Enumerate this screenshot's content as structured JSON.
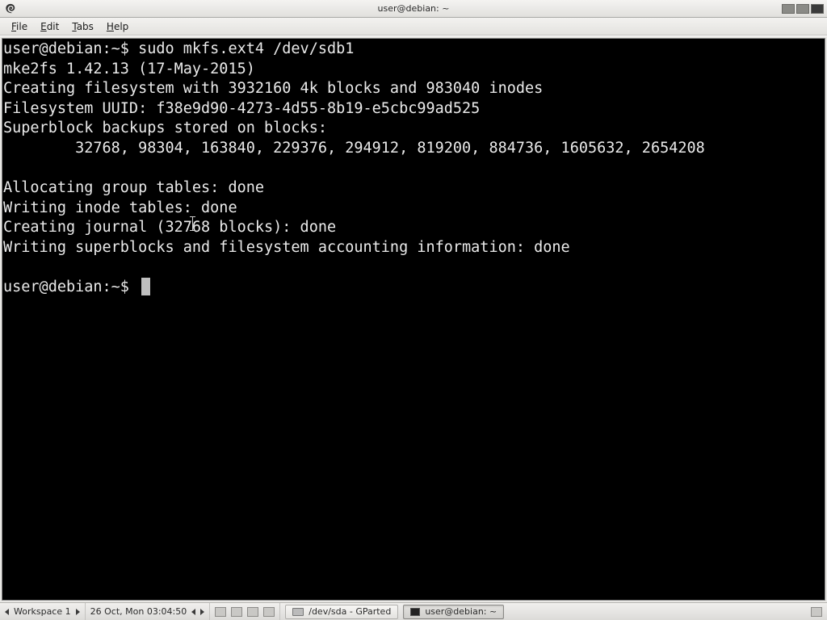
{
  "top_panel": {
    "title": "user@debian: ~"
  },
  "menubar": {
    "file": {
      "label": "File",
      "accel_index": 0
    },
    "edit": {
      "label": "Edit",
      "accel_index": 0
    },
    "tabs": {
      "label": "Tabs",
      "accel_index": 0
    },
    "help": {
      "label": "Help",
      "accel_index": 0
    }
  },
  "terminal": {
    "prompt": "user@debian:~$",
    "command": "sudo mkfs.ext4 /dev/sdb1",
    "out_line1": "mke2fs 1.42.13 (17-May-2015)",
    "out_line2": "Creating filesystem with 3932160 4k blocks and 983040 inodes",
    "out_line3": "Filesystem UUID: f38e9d90-4273-4d55-8b19-e5cbc99ad525",
    "out_line4": "Superblock backups stored on blocks: ",
    "out_line5": "\t32768, 98304, 163840, 229376, 294912, 819200, 884736, 1605632, 2654208",
    "out_blank": "",
    "out_line6": "Allocating group tables: done                            ",
    "out_line7": "Writing inode tables: done                            ",
    "out_line8": "Creating journal (32768 blocks): done",
    "out_line9": "Writing superblocks and filesystem accounting information: done",
    "prompt2": "user@debian:~$"
  },
  "bottom_panel": {
    "workspace_label": "Workspace 1",
    "clock": "26 Oct, Mon 03:04:50",
    "task1": "/dev/sda - GParted",
    "task2": "user@debian: ~"
  }
}
